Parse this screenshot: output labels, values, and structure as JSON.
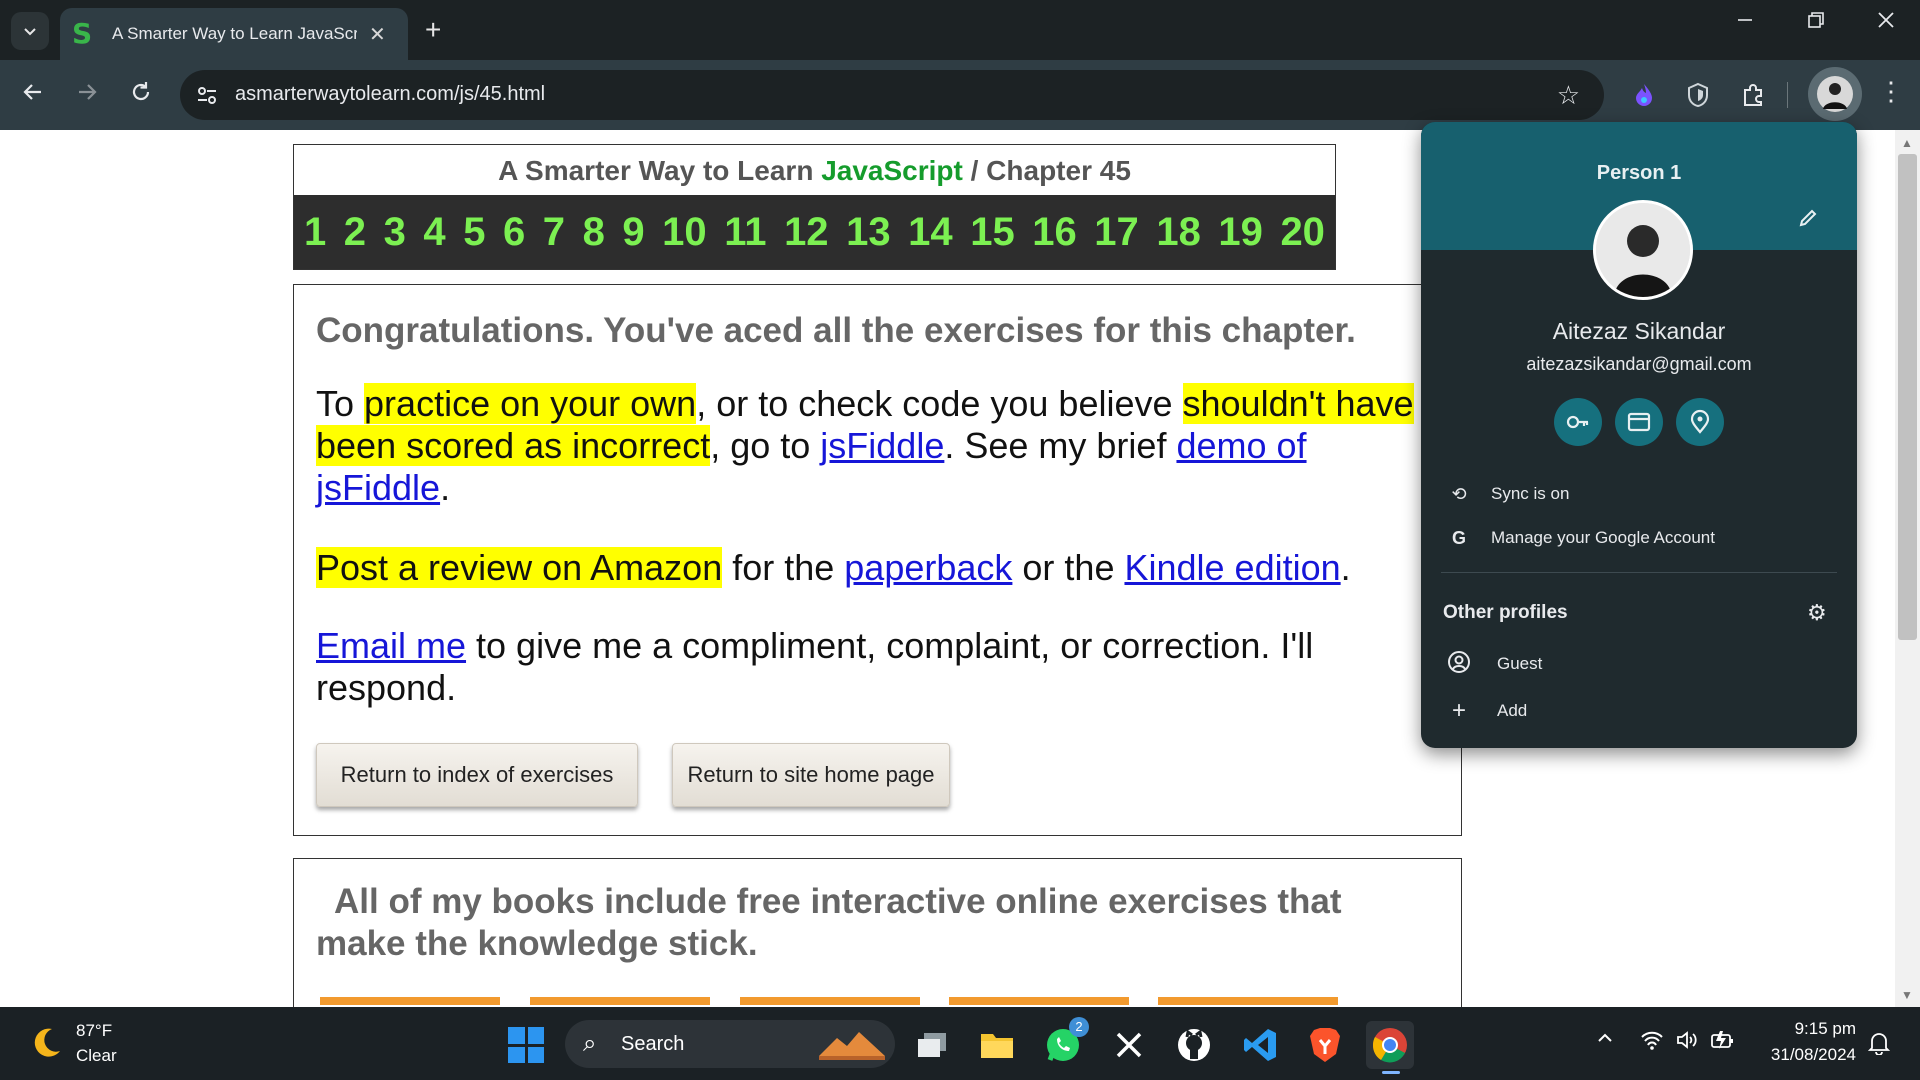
{
  "browser": {
    "tab_title": "A Smarter Way to Learn JavaScr",
    "url": "asmarterwaytolearn.com/js/45.html",
    "new_tab_glyph": "+",
    "close_glyph": "✕"
  },
  "header": {
    "prefix": "A Smarter Way to Learn ",
    "js": "JavaScript",
    "suffix": " / Chapter 45",
    "chapters": [
      "1",
      "2",
      "3",
      "4",
      "5",
      "6",
      "7",
      "8",
      "9",
      "10",
      "11",
      "12",
      "13",
      "14",
      "15",
      "16",
      "17",
      "18",
      "19",
      "20"
    ]
  },
  "main": {
    "congrats": "Congratulations. You've aced all the exercises for this chapter.",
    "p1": {
      "t1": "To ",
      "h1": "practice on your own",
      "t2": ", or to check code you believe ",
      "h2": "shouldn't have been scored as incorrect",
      "t3": ", go to ",
      "l1": "jsFiddle",
      "t4": ". See my brief ",
      "l2": "demo of jsFiddle",
      "t5": "."
    },
    "p2": {
      "h1": "Post a review on Amazon",
      "t1": " for the ",
      "l1": "paperback",
      "t2": " or the ",
      "l2": "Kindle edition",
      "t3": "."
    },
    "p3": {
      "l1": "Email me",
      "t1": " to give me a compliment, complaint, or correction. I'll respond."
    },
    "btn_index": "Return to index of exercises",
    "btn_home": "Return to site home page"
  },
  "books": {
    "text": "All of my books include free interactive online exercises that make the knowledge stick."
  },
  "profile": {
    "top_label": "Person 1",
    "name": "Aitezaz Sikandar",
    "email": "aitezazsikandar@gmail.com",
    "sync": "Sync is on",
    "manage": "Manage your Google Account",
    "other_profiles": "Other profiles",
    "guest": "Guest",
    "add": "Add"
  },
  "taskbar": {
    "temp": "87°F",
    "condition": "Clear",
    "search": "Search",
    "whatsapp_badge": "2",
    "time": "9:15 pm",
    "date": "31/08/2024"
  },
  "colors": {
    "chrome_dark": "#1c2224",
    "chrome_toolbar": "#2f3d44",
    "js_green": "#159c2c",
    "chapter_green": "#7cf052",
    "highlight": "#ffff00",
    "link": "#1616d8",
    "profile_accent": "#17606e"
  }
}
